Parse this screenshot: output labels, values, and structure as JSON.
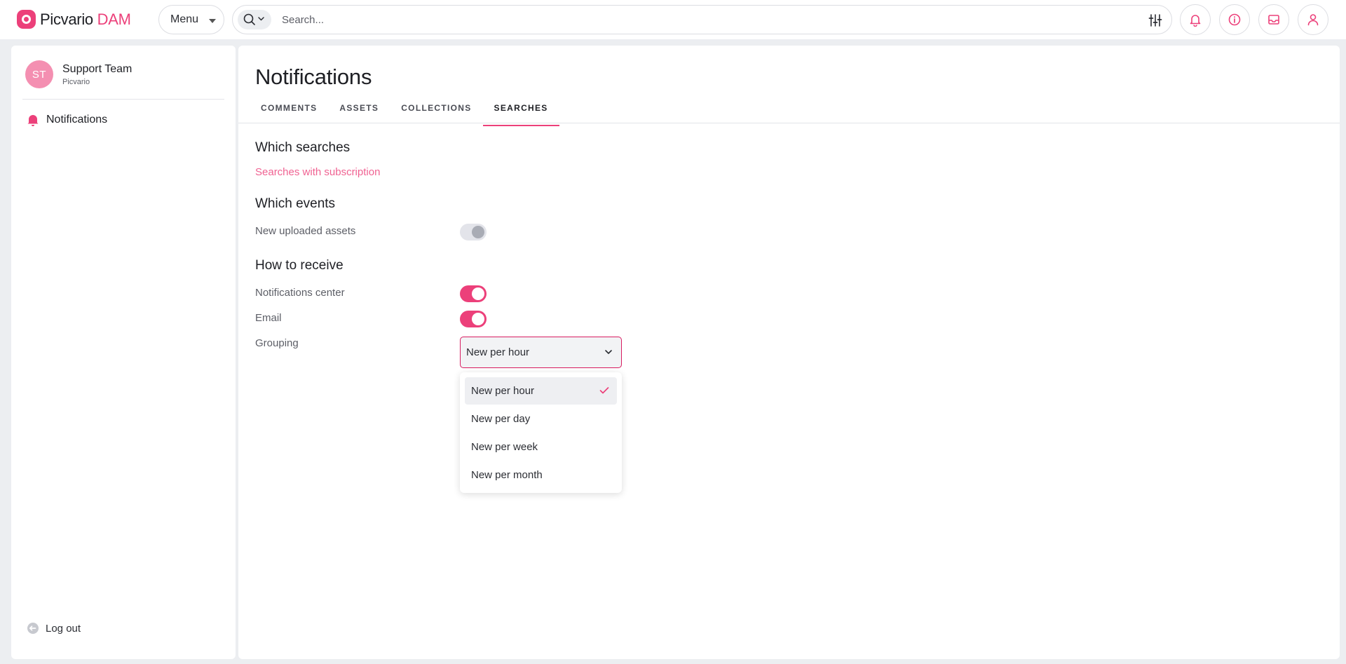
{
  "app": {
    "name": "Picvario",
    "name_accent": "DAM"
  },
  "header": {
    "menu_label": "Menu",
    "search_placeholder": "Search...",
    "icons": [
      "search-icon",
      "filter-icon",
      "bell-icon",
      "info-icon",
      "inbox-icon",
      "user-icon"
    ]
  },
  "sidebar": {
    "profile": {
      "initials": "ST",
      "name": "Support Team",
      "org": "Picvario"
    },
    "items": [
      {
        "label": "Notifications",
        "icon": "bell-icon"
      }
    ],
    "logout_label": "Log out"
  },
  "main": {
    "title": "Notifications",
    "tabs": [
      {
        "label": "COMMENTS",
        "active": false
      },
      {
        "label": "ASSETS",
        "active": false
      },
      {
        "label": "COLLECTIONS",
        "active": false
      },
      {
        "label": "SEARCHES",
        "active": true
      }
    ],
    "which_searches": {
      "heading": "Which searches",
      "link": "Searches with subscription"
    },
    "which_events": {
      "heading": "Which events",
      "new_uploaded_assets": {
        "label": "New uploaded assets",
        "on": false,
        "disabled": true
      }
    },
    "how_to_receive": {
      "heading": "How to receive",
      "notifications_center": {
        "label": "Notifications center",
        "on": true
      },
      "email": {
        "label": "Email",
        "on": true
      },
      "grouping": {
        "label": "Grouping",
        "value": "New per hour",
        "options": [
          "New per hour",
          "New per day",
          "New per week",
          "New per month"
        ]
      }
    }
  },
  "colors": {
    "accent": "#ec407a",
    "link": "#f06292",
    "background": "#eceef1"
  }
}
